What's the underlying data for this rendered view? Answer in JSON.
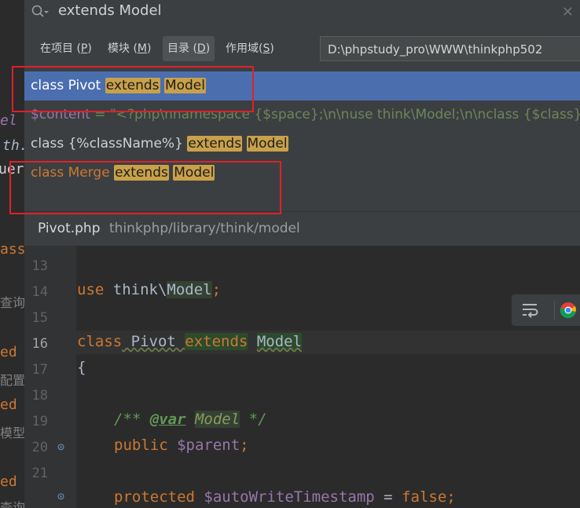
{
  "search": {
    "query": "extends Model"
  },
  "scope_tabs": [
    {
      "label": "在项目 (P)",
      "text": "在项目 ",
      "key": "P"
    },
    {
      "label": "模块 (M)",
      "text": "模块 ",
      "key": "M"
    },
    {
      "label": "目录 (D)",
      "text": "目录 ",
      "key": "D"
    },
    {
      "label": "作用域(S)",
      "text": "作用域",
      "key": "S"
    }
  ],
  "directory_path": "D:\\phpstudy_pro\\WWW\\thinkphp502",
  "results": [
    {
      "pre": "class Pivot ",
      "m1": "extends",
      "m2": "Model"
    },
    {
      "content_var": "$content",
      "content_rest": " = \"<?php\\nnamespace {$space};\\n\\nuse think\\Model;\\n\\nclass {$class} th"
    },
    {
      "pre": "class {%className%} ",
      "m1": "extends",
      "m2": "Model"
    },
    {
      "pre": "class Merge ",
      "m1": "extends",
      "m2": "Model"
    }
  ],
  "file_bar": {
    "name": "Pivot.php",
    "path": "thinkphp/library/think/model"
  },
  "editor": {
    "line_numbers": [
      "13",
      "14",
      "15",
      "16",
      "17",
      "18",
      "19",
      "20",
      "21"
    ],
    "line14": {
      "kw": "use",
      "ns": " think\\",
      "cls": "Model",
      "semi": ";"
    },
    "line16": {
      "kw1": "class",
      "name": " Pivot ",
      "kw2": "extends",
      "sp": " ",
      "cls": "Model"
    },
    "line17": "{",
    "line19": {
      "open": "/** ",
      "tag": "@var",
      "sp": " ",
      "type": "Model",
      "close": " */"
    },
    "line20": {
      "kw": "public",
      "var": " $parent",
      "semi": ";"
    },
    "line22": {
      "kw": "protected",
      "var": " $autoWriteTimestamp",
      "eq": " = ",
      "val": "false",
      "semi": ";"
    }
  },
  "background_fragments": [
    "el",
    "th.",
    "uer",
    "ass",
    "查询",
    "ed",
    "配置",
    "ed",
    "模型",
    "ed",
    "查询"
  ]
}
